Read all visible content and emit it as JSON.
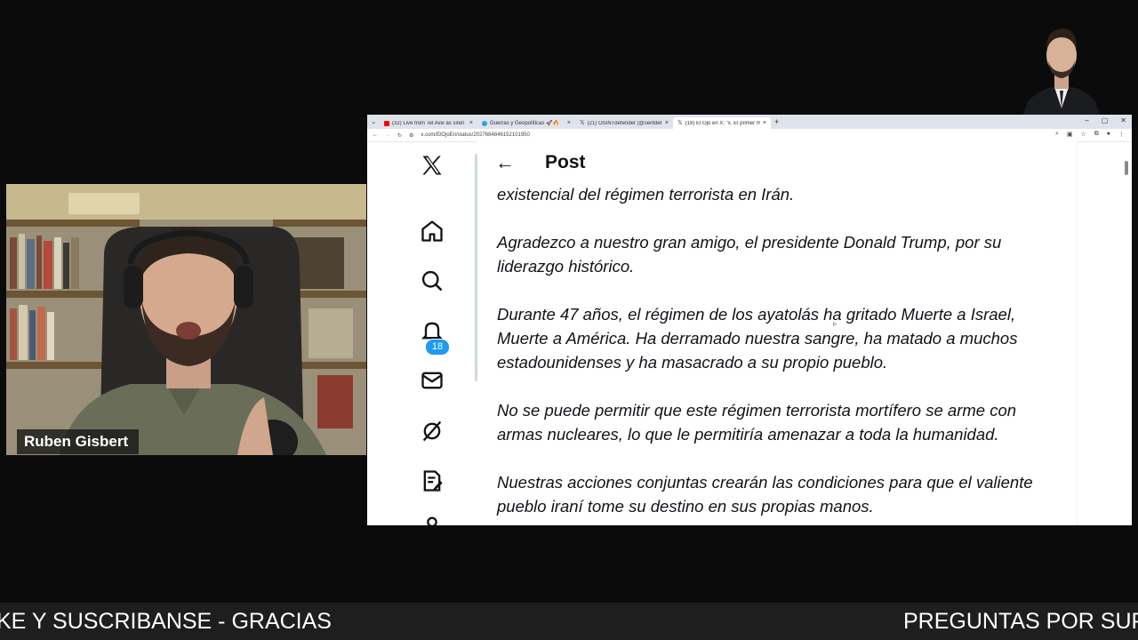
{
  "presenter": {
    "name": "Ruben Gisbert"
  },
  "browser": {
    "tabs": [
      {
        "label": "(32) Live from Tel Aviv as siren",
        "favicon_color": "#ff0000",
        "icon": "youtube-icon"
      },
      {
        "label": "Guerras y Geopolíticas 🚀🔥",
        "favicon_color": "#2ca5e0",
        "icon": "telegram-icon"
      },
      {
        "label": "(21) OSINTdefender (@sentdef",
        "favicon_color": "#000000",
        "icon": "x-icon"
      },
      {
        "label": "(18) El Ojo en X: \"x. El primer m",
        "favicon_color": "#000000",
        "icon": "x-icon"
      }
    ],
    "new_tab": "+",
    "url": "x.com/ElOjoEn/status/2027684846152101950"
  },
  "x": {
    "notification_count": "18",
    "post_header": "Post",
    "paragraphs": [
      "existencial del régimen terrorista en Irán.",
      "Agradezco a nuestro gran amigo, el presidente Donald Trump, por su liderazgo histórico.",
      "Durante 47 años, el régimen de los ayatolás ha gritado Muerte a Israel, Muerte a América. Ha derramado nuestra sangre, ha matado a muchos estadounidenses y ha masacrado a su propio pueblo.",
      "No se puede permitir que este régimen terrorista mortífero se arme con armas nucleares, lo que le permitiría amenazar a toda la humanidad.",
      "Nuestras acciones conjuntas crearán las condiciones para que el valiente pueblo iraní tome su destino en sus propias manos."
    ]
  },
  "ticker": {
    "left_text": "KE Y SUSCRIBANSE - GRACIAS",
    "right_text": "PREGUNTAS POR SUP"
  }
}
